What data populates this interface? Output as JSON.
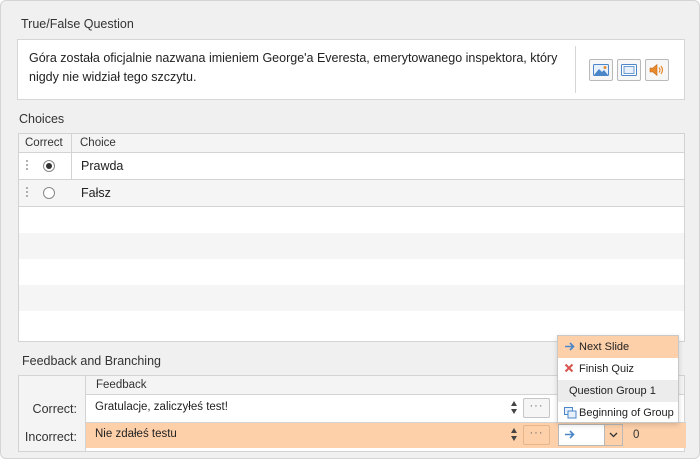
{
  "question_section": {
    "title": "True/False Question",
    "text": "Góra została oficjalnie nazwana imieniem George'a Everesta, emerytowanego inspektora, który nigdy nie widział tego szczytu."
  },
  "choices_section": {
    "title": "Choices",
    "columns": {
      "correct": "Correct",
      "choice": "Choice"
    },
    "rows": [
      {
        "label": "Prawda",
        "correct": true
      },
      {
        "label": "Fałsz",
        "correct": false
      }
    ]
  },
  "feedback_section": {
    "title": "Feedback and Branching",
    "column": "Feedback",
    "rows": [
      {
        "label": "Correct:",
        "feedback": "Gratulacje, zaliczyłeś test!"
      },
      {
        "label": "Incorrect:",
        "feedback": "Nie zdałeś testu"
      }
    ],
    "more_label": "···",
    "score": "0"
  },
  "branch_dropdown": {
    "items": [
      {
        "label": "Next Slide",
        "icon": "arrow-right-icon",
        "selected": true
      },
      {
        "label": "Finish Quiz",
        "icon": "close-icon"
      },
      {
        "label": "Question Group 1",
        "icon": ""
      },
      {
        "label": "Beginning of Group",
        "icon": "group-icon"
      }
    ]
  },
  "colors": {
    "accent": "#fdd0aa",
    "icon_blue": "#4a86c8",
    "icon_orange": "#e8892c",
    "close_red": "#d9534f"
  }
}
